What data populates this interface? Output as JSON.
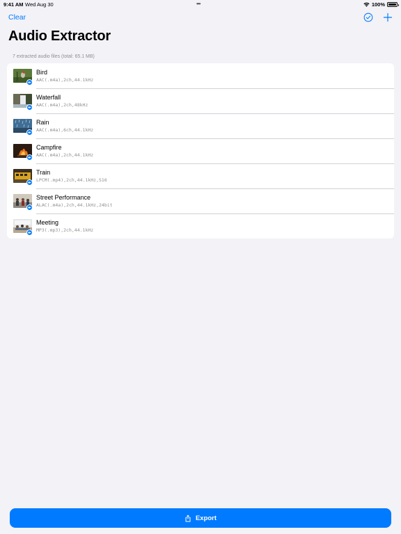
{
  "status_bar": {
    "time": "9:41 AM",
    "date": "Wed Aug 30",
    "battery": "100%",
    "battery_level": 1.0
  },
  "nav": {
    "clear_label": "Clear",
    "select_icon": "checkmark-circle-icon",
    "add_icon": "plus-icon"
  },
  "title": "Audio Extractor",
  "section_header": "7 extracted audio files (total: 65.1 MB)",
  "files": [
    {
      "name": "Bird",
      "meta": "AAC(.m4a),2ch,44.1kHz",
      "thumb_icon": "bird-photo-thumbnail"
    },
    {
      "name": "Waterfall",
      "meta": "AAC(.m4a),2ch,48kHz",
      "thumb_icon": "waterfall-photo-thumbnail"
    },
    {
      "name": "Rain",
      "meta": "AAC(.m4a),6ch,44.1kHz",
      "thumb_icon": "rain-photo-thumbnail"
    },
    {
      "name": "Campfire",
      "meta": "AAC(.m4a),2ch,44.1kHz",
      "thumb_icon": "campfire-photo-thumbnail"
    },
    {
      "name": "Train",
      "meta": "LPCM(.mp4),2ch,44.1kHz,S16",
      "thumb_icon": "train-photo-thumbnail"
    },
    {
      "name": "Street Performance",
      "meta": "ALAC(.m4a),2ch,44.1kHz,24bit",
      "thumb_icon": "street-performance-photo-thumbnail"
    },
    {
      "name": "Meeting",
      "meta": "MP3(.mp3),2ch,44.1kHz",
      "thumb_icon": "meeting-photo-thumbnail"
    }
  ],
  "export": {
    "label": "Export",
    "icon": "share-icon"
  },
  "colors": {
    "accent": "#007aff",
    "background": "#f2f2f7",
    "secondary_text": "#8e8e93"
  }
}
